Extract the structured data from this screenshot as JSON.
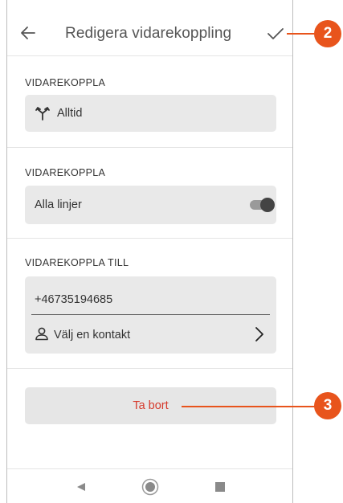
{
  "header": {
    "title": "Redigera vidarekoppling",
    "back_icon": "arrow-left-icon",
    "confirm_icon": "checkmark-icon"
  },
  "sections": [
    {
      "label": "VIDAREKOPPLA",
      "value": "Alltid",
      "icon": "call-forward-icon"
    },
    {
      "label": "VIDAREKOPPLA",
      "value": "Alla linjer",
      "toggle_on": true
    },
    {
      "label": "VIDAREKOPPLA TILL",
      "number": "+46735194685",
      "contact_label": "Välj en kontakt",
      "contact_icon": "person-icon",
      "chevron_icon": "chevron-right-icon"
    }
  ],
  "delete_button": {
    "label": "Ta bort"
  },
  "navbar": {
    "back_icon": "nav-back-icon",
    "home_icon": "nav-home-icon",
    "recents_icon": "nav-recents-icon"
  },
  "callouts": [
    "2",
    "3"
  ],
  "colors": {
    "accent": "#e8541c",
    "delete_text": "#d63a2c",
    "field_bg": "#e9e9e9"
  }
}
